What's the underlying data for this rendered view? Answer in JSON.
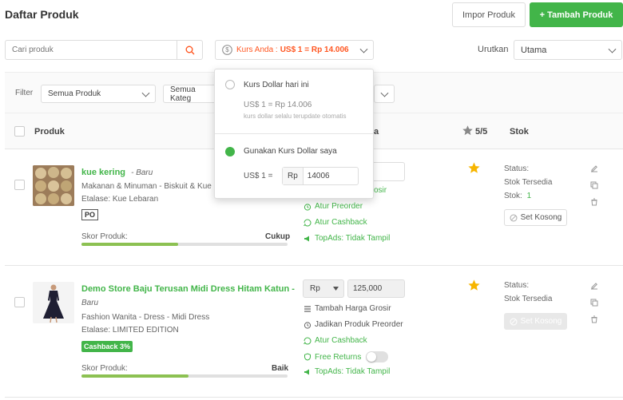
{
  "header": {
    "title": "Daftar Produk",
    "import_label": "Impor Produk",
    "add_label": "+ Tambah Produk"
  },
  "search": {
    "placeholder": "Cari produk",
    "value": ""
  },
  "kurs": {
    "label_prefix": "Kurs Anda : ",
    "label_value": "US$ 1 = Rp 14.006",
    "option1_title": "Kurs Dollar hari ini",
    "option1_rate": "US$ 1 = Rp 14.006",
    "option1_note": "kurs dollar selalu terupdate otomatis",
    "option2_title": "Gunakan Kurs Dollar saya",
    "option2_prefix": "US$ 1 =",
    "option2_currency": "Rp",
    "option2_value": "14006"
  },
  "sort": {
    "label": "Urutkan",
    "value": "Utama"
  },
  "filter": {
    "label": "Filter",
    "select1": "Semua Produk",
    "select2": "Semua Kateg"
  },
  "table_header": {
    "produk": "Produk",
    "harga": "a",
    "rating": "5/5",
    "stok": "Stok"
  },
  "products": [
    {
      "name": "kue kering",
      "condition": "- Baru",
      "category": "Makanan & Minuman - Biskuit & Kue - Ku",
      "etalase": "Etalase:  Kue Lebaran",
      "badge": "PO",
      "score_label": "Skor Produk:",
      "score_value": "Cukup",
      "score_fraction": 0.47,
      "actions": [
        "osir",
        "Atur Preorder",
        "Atur Cashback",
        "TopAds: Tidak Tampil"
      ],
      "status_label": "Status:",
      "status_value": "Stok Tersedia",
      "stock_label": "Stok:",
      "stock_value": "1",
      "stock_btn": "Set Kosong"
    },
    {
      "name": "Demo Store Baju Terusan Midi Dress Hitam Katun -",
      "condition": "Baru",
      "category": "Fashion Wanita - Dress - Midi Dress",
      "etalase": "Etalase:  LIMITED EDITION",
      "badge": "Cashback 3%",
      "score_label": "Skor Produk:",
      "score_value": "Baik",
      "score_fraction": 0.52,
      "currency": "Rp",
      "price": "125,000",
      "actions": [
        "Tambah Harga Grosir",
        "Jadikan Produk Preorder",
        "Atur Cashback",
        "Free Returns",
        "TopAds: Tidak Tampil"
      ],
      "status_label": "Status:",
      "status_value": "Stok Tersedia",
      "stock_btn": "Set Kosong"
    }
  ],
  "colors": {
    "accent": "#42b549",
    "warning": "#ff5722",
    "star": "#f7b500"
  }
}
